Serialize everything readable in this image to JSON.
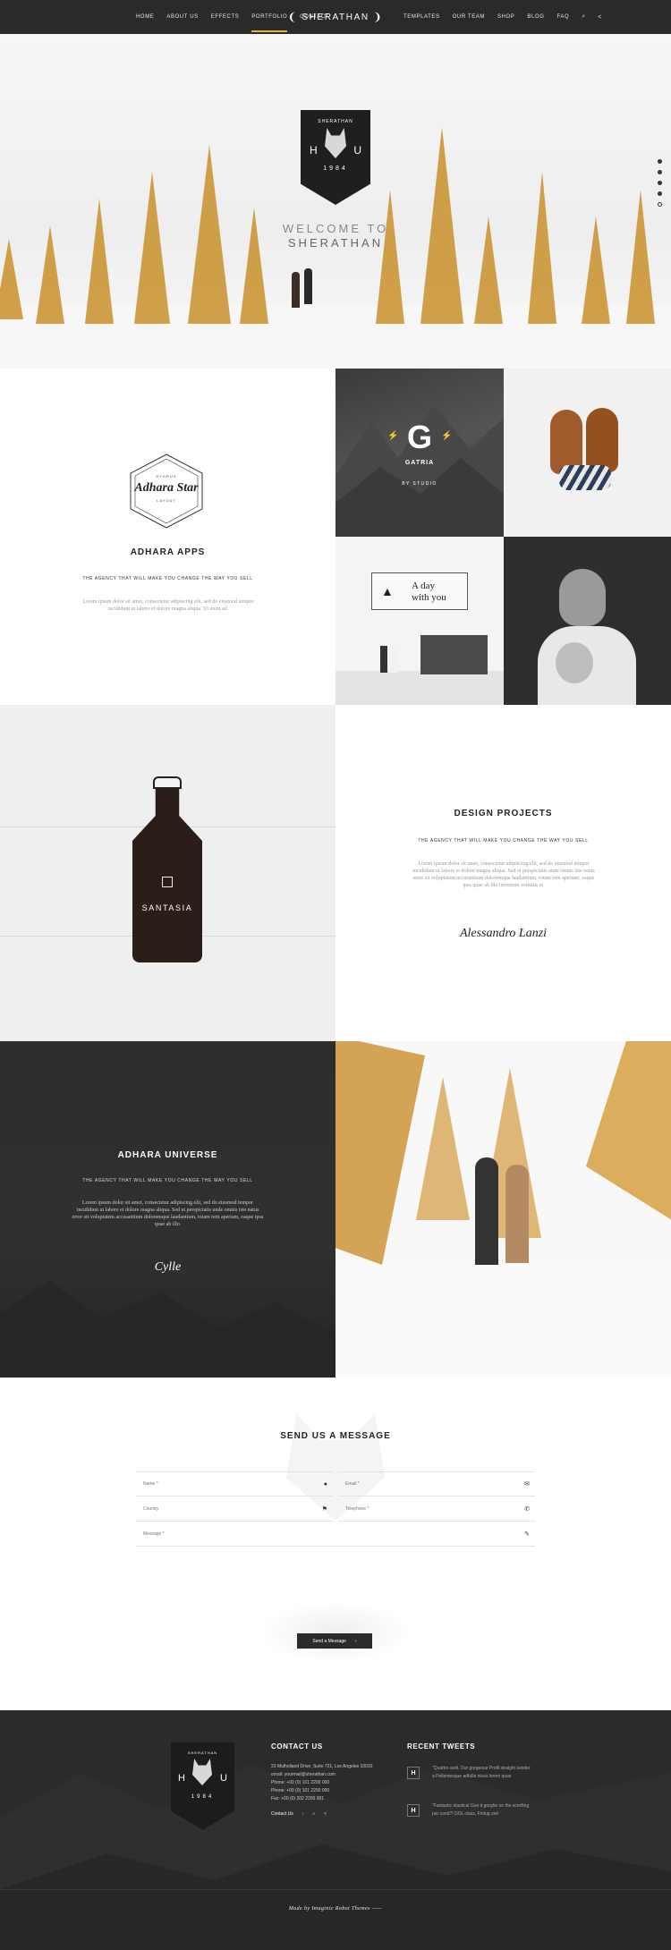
{
  "nav": {
    "left": [
      "Home",
      "About Us",
      "Effects",
      "Portfolio",
      "Contact"
    ],
    "brand": "SHERATHAN",
    "right": [
      "Templates",
      "Our Team",
      "Shop",
      "Blog",
      "FAQ"
    ],
    "active_index": 3
  },
  "hero": {
    "badge_top": "SHERATHAN",
    "badge_h": "H",
    "badge_u": "U",
    "badge_year": "1984",
    "welcome": "WELCOME TO",
    "title": "SHERATHAN"
  },
  "adhara_apps": {
    "logo_top": "HYDRUS",
    "logo_script": "Adhara Star",
    "logo_bottom": "LAYOUT",
    "title": "ADHARA APPS",
    "subtitle": "THE AGENCY THAT WILL MAKE YOU CHANGE THE WAY YOU SELL",
    "body": "Lorem ipsum dolor sit amet, consectetur adipiscing elit, sed do eiusmod tempor incididunt ut labore et dolore magna aliqua. Ut enim ad."
  },
  "gatria": {
    "letter": "G",
    "name": "GATRIA",
    "sub": "BY STUDIO"
  },
  "aday": {
    "line1": "A day",
    "line2": "with you"
  },
  "santasia": {
    "name": "SANTASIA"
  },
  "design": {
    "title": "DESIGN PROJECTS",
    "subtitle": "THE AGENCY THAT WILL MAKE YOU CHANGE THE WAY YOU SELL",
    "body": "Lorem ipsum dolor sit amet, consectetur adipiscing elit, sed do eiusmod tempor incididunt ut labore et dolore magna aliqua. Sed ut perspiciatis unde omnis iste natus error sit voluptatem accusantium doloremque laudantium, totam rem aperiam, eaque ipsa quae ab illo inventore veritatis et.",
    "signature": "Alessandro Lanzi"
  },
  "universe": {
    "title": "ADHARA UNIVERSE",
    "subtitle": "THE AGENCY THAT WILL MAKE YOU CHANGE THE WAY YOU SELL",
    "body": "Lorem ipsum dolor sit amet, consectetur adipiscing elit, sed do eiusmod tempor incididunt ut labore et dolore magna aliqua. Sed ut perspiciatis unde omnis iste natus error sit voluptatem accusantium doloremque laudantium, totam rem aperiam, eaque ipsa quae ab illo.",
    "signature": "Cylle"
  },
  "contact": {
    "title": "SEND US A MESSAGE",
    "name_placeholder": "Name *",
    "email_placeholder": "Email *",
    "country_placeholder": "Country",
    "telephone_placeholder": "Telephone *",
    "message_placeholder": "Message *",
    "send_label": "Send a Message",
    "send_arrow": "›"
  },
  "footer": {
    "badge_top": "SHERATHAN",
    "badge_h": "H",
    "badge_u": "U",
    "badge_year": "1984",
    "contact_title": "CONTACT US",
    "address": "23 Mulholland Drive, Suite 721, Los Angeles 10010",
    "email": "email: yourmail@sherathan.com",
    "phone1": "Phone: +00 (0) 101 2200 000",
    "phone2": "Phone: +00 (0) 101 2200 000",
    "fax": "Fax: +00 (0) 202 2200 001",
    "contact_link": "Contact Us",
    "tweets_title": "RECENT TWEETS",
    "tweets": [
      {
        "text": "\"Quattro vedi. Our gorgeous Profil straight sender a Pellentesque adfulla nissa lorem quas"
      },
      {
        "text": "\"Fantastic elastical Goo it gorghe on the scrolling per cond?! DOL class, Fintug ore!"
      }
    ],
    "made_by": "Made by Imaginic Robot Themes"
  }
}
